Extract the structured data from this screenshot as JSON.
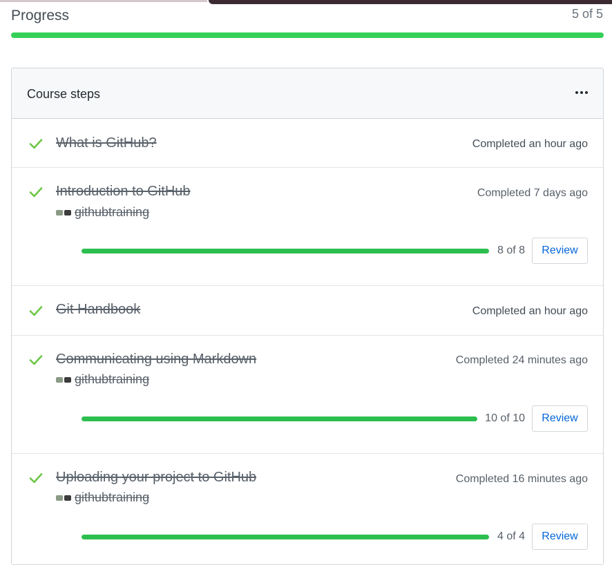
{
  "progress": {
    "title": "Progress",
    "count": "5 of 5",
    "fraction": 1.0,
    "bar_color": "#34d058"
  },
  "course": {
    "title": "Course steps",
    "menu_icon": "kebab-horizontal-icon",
    "steps": [
      {
        "title": "What is GitHub?",
        "status": "Completed an hour ago"
      },
      {
        "title": "Introduction to GitHub",
        "status": "Completed 7 days ago",
        "owner": "githubtraining",
        "count": "8 of 8",
        "fraction": 1.0,
        "review_label": "Review"
      },
      {
        "title": "Git Handbook",
        "status": "Completed an hour ago"
      },
      {
        "title": "Communicating using Markdown",
        "status": "Completed 24 minutes ago",
        "owner": "githubtraining",
        "count": "10 of 10",
        "fraction": 1.0,
        "review_label": "Review"
      },
      {
        "title": "Uploading your project to GitHub",
        "status": "Completed 16 minutes ago",
        "owner": "githubtraining",
        "count": "4 of 4",
        "fraction": 1.0,
        "review_label": "Review"
      }
    ]
  },
  "colors": {
    "check": "#6cc644",
    "step_bar": "#2cbe4e",
    "link": "#0366d6"
  }
}
